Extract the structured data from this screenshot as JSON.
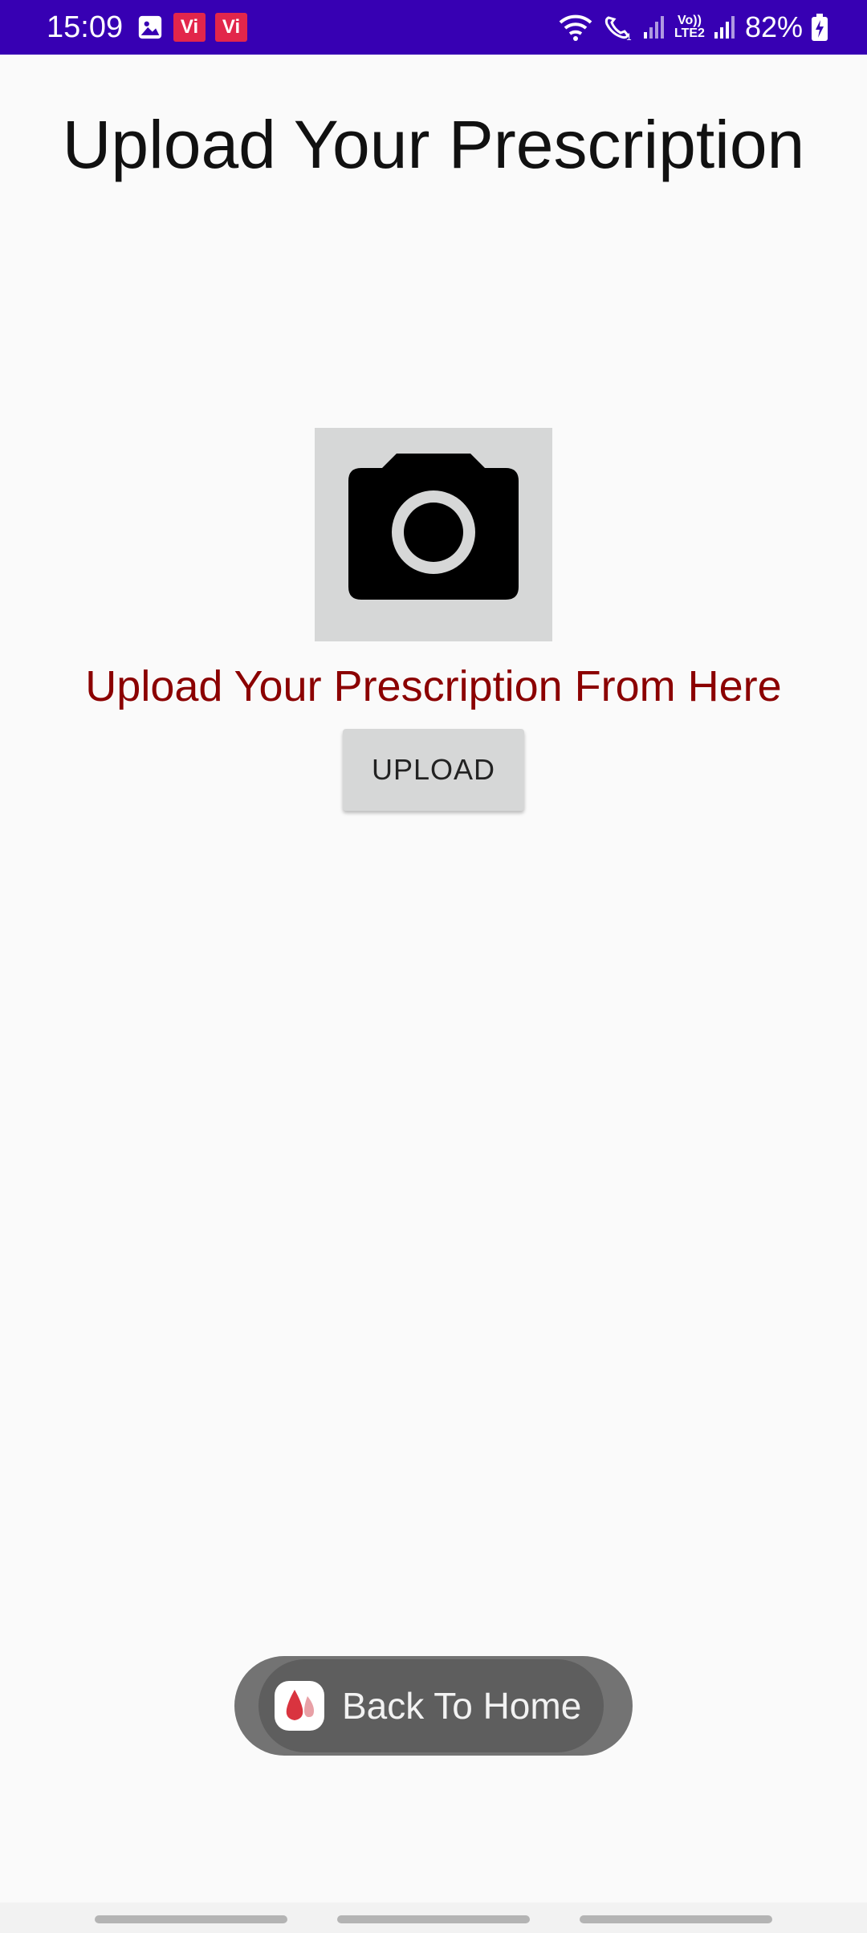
{
  "status_bar": {
    "time": "15:09",
    "carrier_badges": [
      "Vi",
      "Vi"
    ],
    "icons": [
      "gallery-icon",
      "wifi-icon",
      "wifi-calling-icon",
      "signal-icon",
      "volte-icon",
      "signal-icon",
      "battery-charging-icon"
    ],
    "volte_label": "Vo))",
    "lte_label": "LTE2",
    "battery_percent": "82%",
    "background_color": "#3700b3"
  },
  "main": {
    "title": "Upload Your Prescription",
    "image_placeholder_icon": "camera-icon",
    "subtitle": "Upload Your Prescription From Here",
    "subtitle_color": "#8b0000",
    "upload_button_label": "UPLOAD"
  },
  "toast": {
    "app_icon": "blood-drop-icon",
    "message": "Back To Home"
  },
  "nav_bar": {
    "pills": 3
  }
}
